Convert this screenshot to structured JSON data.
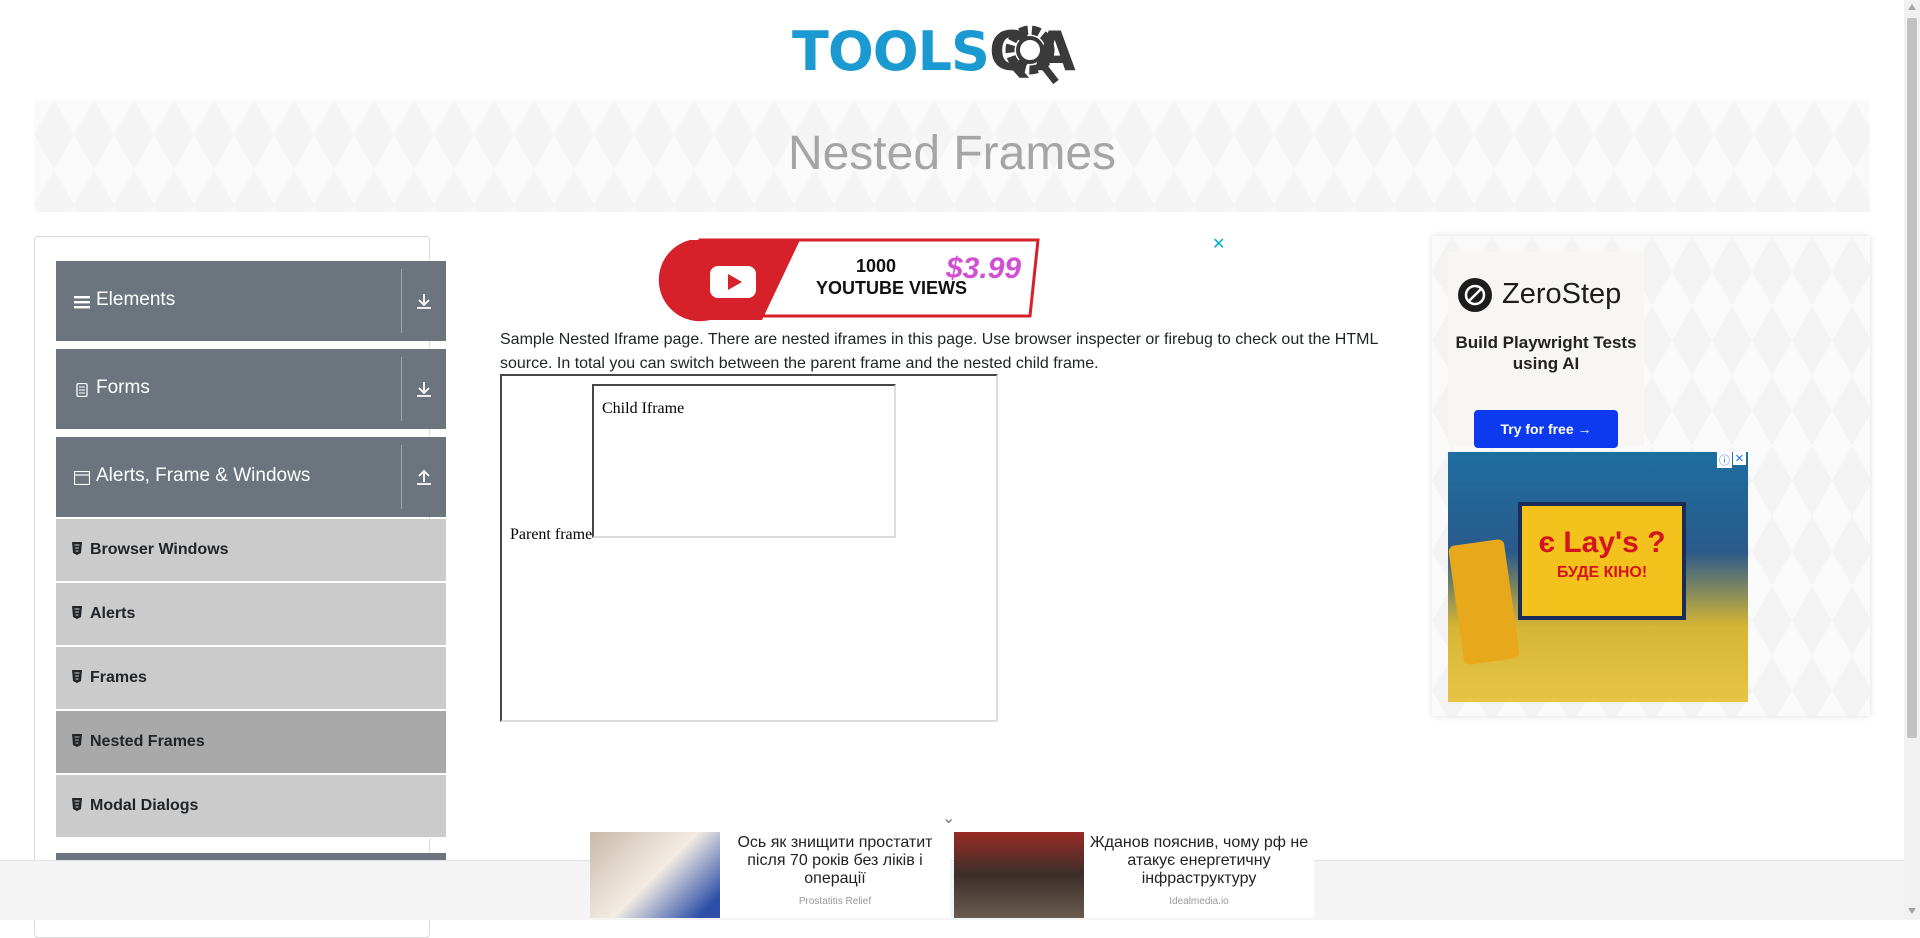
{
  "header": {
    "logo_tools": "TOOLS",
    "logo_qa": "QA"
  },
  "banner": {
    "title": "Nested Frames"
  },
  "sidebar": {
    "groups": [
      {
        "label": "Elements",
        "icon": "menu-icon",
        "expanded": false
      },
      {
        "label": "Forms",
        "icon": "document-icon",
        "expanded": false
      },
      {
        "label": "Alerts, Frame & Windows",
        "icon": "window-icon",
        "expanded": true
      }
    ],
    "items": [
      {
        "label": "Browser Windows",
        "active": false
      },
      {
        "label": "Alerts",
        "active": false
      },
      {
        "label": "Frames",
        "active": false
      },
      {
        "label": "Nested Frames",
        "active": true
      },
      {
        "label": "Modal Dialogs",
        "active": false
      }
    ]
  },
  "ad_top": {
    "line1": "1000",
    "line2": "YOUTUBE VIEWS",
    "price": "$3.99",
    "close": "✕"
  },
  "main": {
    "description": "Sample Nested Iframe page. There are nested iframes in this page. Use browser inspecter or firebug to check out the HTML source. In total you can switch between the parent frame and the nested child frame.",
    "parent_frame_label": "Parent frame",
    "child_frame_label": "Child Iframe"
  },
  "right_ads": {
    "zerostep_brand": "ZeroStep",
    "zerostep_tagline": "Build Playwright Tests using AI",
    "zerostep_button": "Try for free →",
    "lays_title": "є Lay's ?",
    "lays_sub": "БУДЕ КІНО!",
    "adchoices": "ⓘ",
    "adclose": "✕"
  },
  "bottom_ads": {
    "chevron": "⌄",
    "items": [
      {
        "title": "Ось як знищити простатит після 70 років без ліків і операції",
        "source": "Prostatitis Relief"
      },
      {
        "title": "Жданов пояснив, чому рф не атакує енергетичну інфраструктуру",
        "source": "Idealmedia.io"
      }
    ]
  },
  "colors": {
    "brand_blue": "#1b9ad2",
    "sidebar_header": "#6c757d",
    "sidebar_item": "#cbcbcb",
    "sidebar_active": "#a9a9a9",
    "cta_blue": "#0d3aef"
  }
}
